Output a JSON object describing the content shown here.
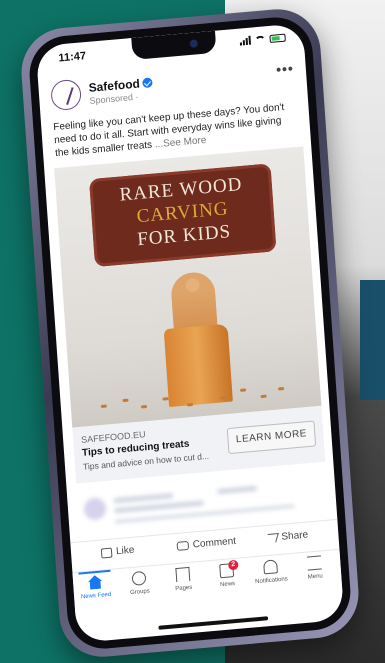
{
  "status_bar": {
    "time": "11:47"
  },
  "post": {
    "page_name": "Safefood",
    "sponsored": "Sponsored · ",
    "more_menu": "•••",
    "caption": "Feeling like you can't keep up these days? You don't need to do it all. Start with everyday wins like giving the kids smaller treats",
    "see_more": "...See More"
  },
  "ad_image": {
    "line1": "RARE WOOD",
    "line2": "CARVING",
    "line3": "FOR KIDS"
  },
  "ad_footer": {
    "domain": "SAFEFOOD.EU",
    "title": "Tips to reducing treats",
    "description": "Tips and advice on how to cut d...",
    "cta": "LEARN MORE"
  },
  "actions": {
    "like": "Like",
    "comment": "Comment",
    "share": "Share"
  },
  "tabbar": [
    {
      "label": "News Feed",
      "icon": "home-icon",
      "active": true
    },
    {
      "label": "Groups",
      "icon": "groups-icon"
    },
    {
      "label": "Pages",
      "icon": "flag-icon"
    },
    {
      "label": "News",
      "icon": "news-icon",
      "badge": "2"
    },
    {
      "label": "Notifications",
      "icon": "bell-icon"
    },
    {
      "label": "Menu",
      "icon": "menu-icon"
    }
  ],
  "colors": {
    "background": "#0e7366",
    "accent": "#1877f2",
    "sign": "#6d2a1d",
    "sign_highlight": "#e2a93b"
  }
}
